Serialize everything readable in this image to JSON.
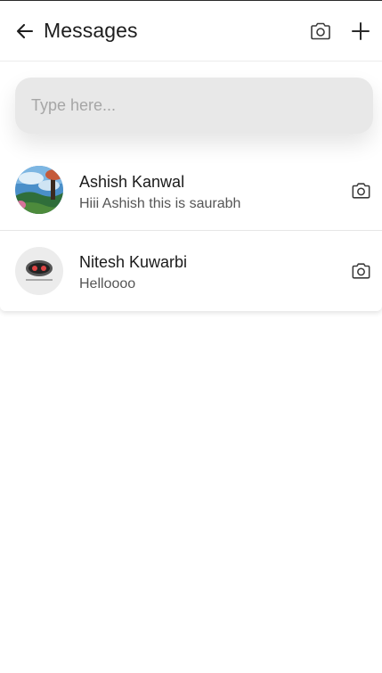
{
  "header": {
    "title": "Messages",
    "back_icon": "arrow-left-icon",
    "camera_icon": "camera-icon",
    "new_icon": "plus-icon"
  },
  "search": {
    "placeholder": "Type here...",
    "value": ""
  },
  "conversations": [
    {
      "name": "Ashish Kanwal",
      "last_message": "Hiii Ashish this is saurabh",
      "avatar": "landscape-photo",
      "action_icon": "camera-icon"
    },
    {
      "name": "Nitesh Kuwarbi",
      "last_message": "Helloooo",
      "avatar": "mask-logo",
      "action_icon": "camera-icon"
    }
  ],
  "colors": {
    "text_primary": "#1d1d1d",
    "text_secondary": "#555555",
    "placeholder": "#a6a6a6",
    "search_bg": "#e8e8e8",
    "divider": "#e6e6e6"
  }
}
